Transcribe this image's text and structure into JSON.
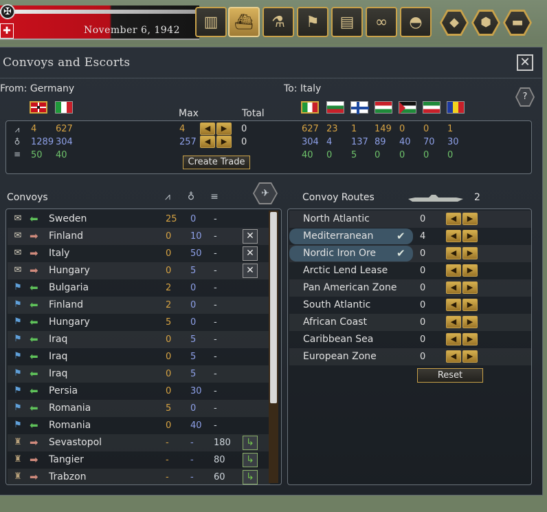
{
  "topbar": {
    "date": "November 6, 1942",
    "buttons": [
      "factory-icon",
      "ship-icon",
      "research-icon",
      "flag-icon",
      "clipboard-icon",
      "binoculars-icon",
      "helmet-icon"
    ],
    "hex_buttons": [
      "terrain-icon",
      "hex-map-icon",
      "train-icon"
    ]
  },
  "panel": {
    "title": "Convoys and Escorts",
    "from_label": "From: Germany",
    "to_label": "To: Italy",
    "max_label": "Max",
    "total_label": "Total",
    "help_label": "?",
    "create_trade_label": "Create Trade",
    "colors": {
      "yellow": "#d8a443",
      "blue": "#8ea0e8",
      "green": "#6fc36b"
    }
  },
  "trade": {
    "from_values": {
      "row1": [
        "4",
        "627"
      ],
      "row2": [
        "1289",
        "304"
      ],
      "row3": [
        "50",
        "40"
      ]
    },
    "max": [
      "4",
      "257"
    ],
    "total": [
      "0",
      "0"
    ],
    "to_values": {
      "row1": [
        "627",
        "23",
        "1",
        "149",
        "0",
        "0",
        "1"
      ],
      "row2": [
        "304",
        "4",
        "137",
        "89",
        "40",
        "70",
        "30"
      ],
      "row3": [
        "40",
        "0",
        "5",
        "0",
        "0",
        "0",
        "0"
      ]
    }
  },
  "convoys": {
    "heading": "Convoys",
    "rows": [
      {
        "icon": "scroll-icon",
        "dir": "in",
        "name": "Sweden",
        "v1": "25",
        "v2": "0",
        "v3": "-",
        "action": ""
      },
      {
        "icon": "scroll-icon",
        "dir": "out",
        "name": "Finland",
        "v1": "0",
        "v2": "10",
        "v3": "-",
        "action": "delete"
      },
      {
        "icon": "scroll-icon",
        "dir": "out",
        "name": "Italy",
        "v1": "0",
        "v2": "50",
        "v3": "-",
        "action": "delete"
      },
      {
        "icon": "scroll-icon",
        "dir": "out",
        "name": "Hungary",
        "v1": "0",
        "v2": "5",
        "v3": "-",
        "action": "delete"
      },
      {
        "icon": "flag-icon",
        "dir": "in",
        "name": "Bulgaria",
        "v1": "2",
        "v2": "0",
        "v3": "-",
        "action": ""
      },
      {
        "icon": "flag-icon",
        "dir": "in",
        "name": "Finland",
        "v1": "2",
        "v2": "0",
        "v3": "-",
        "action": ""
      },
      {
        "icon": "flag-icon",
        "dir": "in",
        "name": "Hungary",
        "v1": "5",
        "v2": "0",
        "v3": "-",
        "action": ""
      },
      {
        "icon": "flag-icon",
        "dir": "in",
        "name": "Iraq",
        "v1": "0",
        "v2": "5",
        "v3": "-",
        "action": ""
      },
      {
        "icon": "flag-icon",
        "dir": "in",
        "name": "Iraq",
        "v1": "0",
        "v2": "5",
        "v3": "-",
        "action": ""
      },
      {
        "icon": "flag-icon",
        "dir": "in",
        "name": "Iraq",
        "v1": "0",
        "v2": "5",
        "v3": "-",
        "action": ""
      },
      {
        "icon": "flag-icon",
        "dir": "in",
        "name": "Persia",
        "v1": "0",
        "v2": "30",
        "v3": "-",
        "action": ""
      },
      {
        "icon": "flag-icon",
        "dir": "in",
        "name": "Romania",
        "v1": "5",
        "v2": "0",
        "v3": "-",
        "action": ""
      },
      {
        "icon": "flag-icon",
        "dir": "in",
        "name": "Romania",
        "v1": "0",
        "v2": "40",
        "v3": "-",
        "action": ""
      },
      {
        "icon": "supply-icon",
        "dir": "out",
        "name": "Sevastopol",
        "v1": "-",
        "v2": "-",
        "v3": "180",
        "action": "route"
      },
      {
        "icon": "supply-icon",
        "dir": "out",
        "name": "Tangier",
        "v1": "-",
        "v2": "-",
        "v3": "80",
        "action": "route"
      },
      {
        "icon": "supply-icon",
        "dir": "out",
        "name": "Trabzon",
        "v1": "-",
        "v2": "-",
        "v3": "60",
        "action": "route"
      }
    ]
  },
  "routes": {
    "heading": "Convoy Routes",
    "ship_count": "2",
    "reset_label": "Reset",
    "rows": [
      {
        "name": "North Atlantic",
        "value": "0",
        "selected": false
      },
      {
        "name": "Mediterranean",
        "value": "4",
        "selected": true
      },
      {
        "name": "Nordic Iron Ore",
        "value": "0",
        "selected": true
      },
      {
        "name": "Arctic Lend Lease",
        "value": "0",
        "selected": false
      },
      {
        "name": "Pan American Zone",
        "value": "0",
        "selected": false
      },
      {
        "name": "South Atlantic",
        "value": "0",
        "selected": false
      },
      {
        "name": "African Coast",
        "value": "0",
        "selected": false
      },
      {
        "name": "Caribbean Sea",
        "value": "0",
        "selected": false
      },
      {
        "name": "European Zone",
        "value": "0",
        "selected": false
      }
    ]
  }
}
